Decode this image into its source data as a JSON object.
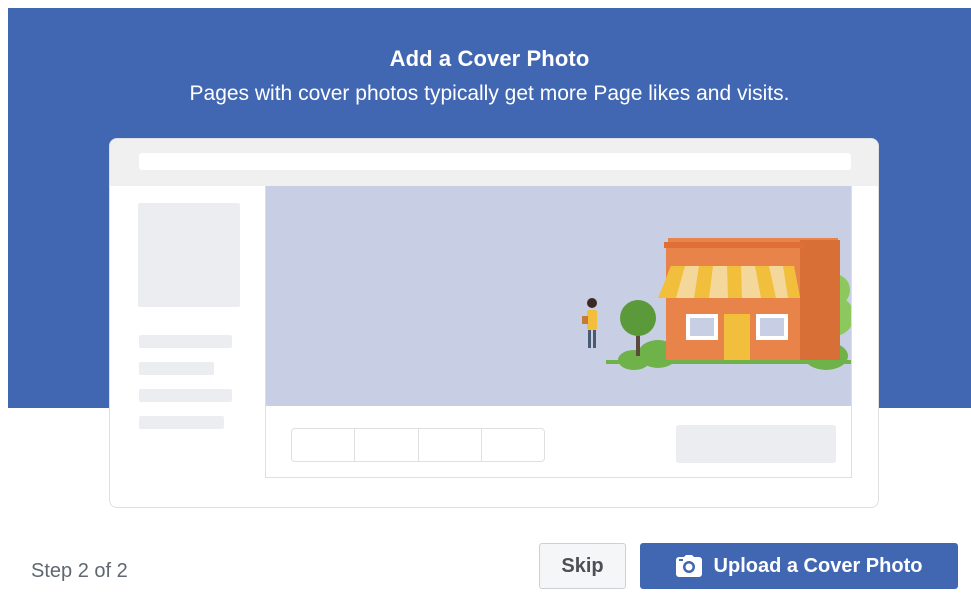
{
  "dialog": {
    "title": "Add a Cover Photo",
    "subtitle": "Pages with cover photos typically get more Page likes and visits."
  },
  "footer": {
    "step_text": "Step 2 of 2",
    "skip_label": "Skip",
    "upload_label": "Upload a Cover Photo",
    "upload_icon": "camera-icon"
  },
  "colors": {
    "brand_blue": "#4267b2",
    "cover_bg": "#c8cfe5",
    "placeholder_gray": "#ebedf0"
  }
}
